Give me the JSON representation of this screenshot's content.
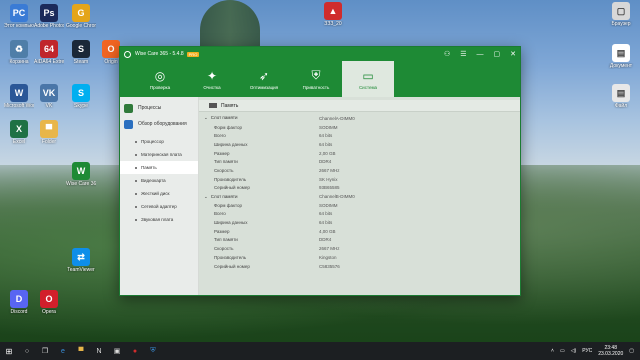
{
  "desktop_icons": [
    {
      "label": "Этот компьютер",
      "icon": "computer-icon",
      "color": "#3a7bd5",
      "text": "PC"
    },
    {
      "label": "Adobe Photoshop CS6",
      "icon": "photoshop-icon",
      "color": "#1b2a5a",
      "text": "Ps"
    },
    {
      "label": "Google Chrome",
      "icon": "chrome-icon",
      "color": "#e4a51a",
      "text": "G"
    },
    {
      "label": "Корзина",
      "icon": "recycle-bin-icon",
      "color": "#4f7ea8",
      "text": "♻"
    },
    {
      "label": "AIDA64 Extreme",
      "icon": "aida64-icon",
      "color": "#c0262c",
      "text": "64"
    },
    {
      "label": "Steam",
      "icon": "steam-icon",
      "color": "#1b2838",
      "text": "S"
    },
    {
      "label": "Origin",
      "icon": "origin-icon",
      "color": "#f26522",
      "text": "O"
    },
    {
      "label": "Microsoft Word",
      "icon": "word-icon",
      "color": "#2b5797",
      "text": "W"
    },
    {
      "label": "VK",
      "icon": "vk-icon",
      "color": "#4a76a8",
      "text": "VK"
    },
    {
      "label": "Skype",
      "icon": "skype-icon",
      "color": "#00aff0",
      "text": "S"
    },
    {
      "label": "Excel",
      "icon": "excel-icon",
      "color": "#1e7145",
      "text": "X"
    },
    {
      "label": "Folder",
      "icon": "folder-icon",
      "color": "#e8b64a",
      "text": "▀"
    },
    {
      "label": "Wise Care 365",
      "icon": "wisecare-icon",
      "color": "#1e8a35",
      "text": "W"
    },
    {
      "label": "TeamViewer",
      "icon": "teamviewer-icon",
      "color": "#0e8ee9",
      "text": "⇄"
    },
    {
      "label": "Discord",
      "icon": "discord-icon",
      "color": "#5865f2",
      "text": "D"
    },
    {
      "label": "Opera",
      "icon": "opera-icon",
      "color": "#d21f2b",
      "text": "O"
    }
  ],
  "right_icons": [
    {
      "label": "Браузер",
      "icon": "browser-icon",
      "color": "#d8d8d8",
      "text": "▢"
    },
    {
      "label": "Документ",
      "icon": "document-icon",
      "color": "#ffffff",
      "text": "▤"
    },
    {
      "label": "Файл",
      "icon": "file-icon",
      "color": "#e8e8e8",
      "text": "▤"
    }
  ],
  "center_icon": {
    "label": "ЗЗЗ_20",
    "icon": "app-icon",
    "color": "#d02c2c",
    "text": "▲"
  },
  "app": {
    "name": "Wise Care 365 - 5.4.8",
    "badge": "PRO",
    "toolbar": [
      {
        "label": "Проверка",
        "icon": "check-icon",
        "glyph": "◎"
      },
      {
        "label": "Очистка",
        "icon": "broom-icon",
        "glyph": "✦"
      },
      {
        "label": "Оптимизация",
        "icon": "rocket-icon",
        "glyph": "➶"
      },
      {
        "label": "Приватность",
        "icon": "shield-icon",
        "glyph": "⛨"
      },
      {
        "label": "Система",
        "icon": "monitor-icon",
        "glyph": "▭"
      }
    ],
    "active_tab": 4,
    "sidebar": {
      "sections": [
        {
          "label": "Процессы"
        },
        {
          "label": "Обзор оборудования"
        }
      ],
      "items": [
        "Процессор",
        "Материнская плата",
        "Память",
        "Видеокарта",
        "Жесткий диск",
        "Сетевой адаптер",
        "Звуковая плата"
      ],
      "selected": 2
    },
    "main": {
      "title": "Память",
      "slots": [
        {
          "slot_label": "Слот памяти",
          "slot_value": "ChannelA-DIMM0",
          "rows": [
            {
              "k": "Форм фактор",
              "v": "SODIMM"
            },
            {
              "k": "Всего",
              "v": "64 bits"
            },
            {
              "k": "Ширина данных",
              "v": "64 bits"
            },
            {
              "k": "Размер",
              "v": "2,00 GB"
            },
            {
              "k": "Тип памяти",
              "v": "DDR4"
            },
            {
              "k": "Скорость",
              "v": "2667 MHz"
            },
            {
              "k": "Производитель",
              "v": "SK Hynix"
            },
            {
              "k": "Серийный номер",
              "v": "93B65585"
            }
          ]
        },
        {
          "slot_label": "Слот памяти",
          "slot_value": "ChannelB-DIMM0",
          "rows": [
            {
              "k": "Форм фактор",
              "v": "SODIMM"
            },
            {
              "k": "Всего",
              "v": "64 bits"
            },
            {
              "k": "Ширина данных",
              "v": "64 bits"
            },
            {
              "k": "Размер",
              "v": "4,00 GB"
            },
            {
              "k": "Тип памяти",
              "v": "DDR4"
            },
            {
              "k": "Скорость",
              "v": "2667 MHz"
            },
            {
              "k": "Производитель",
              "v": "Kingston"
            },
            {
              "k": "Серийный номер",
              "v": "C5835576"
            }
          ]
        }
      ]
    }
  },
  "taskbar": {
    "lang": "РУС",
    "time": "23:48",
    "date": "23.03.2020"
  }
}
